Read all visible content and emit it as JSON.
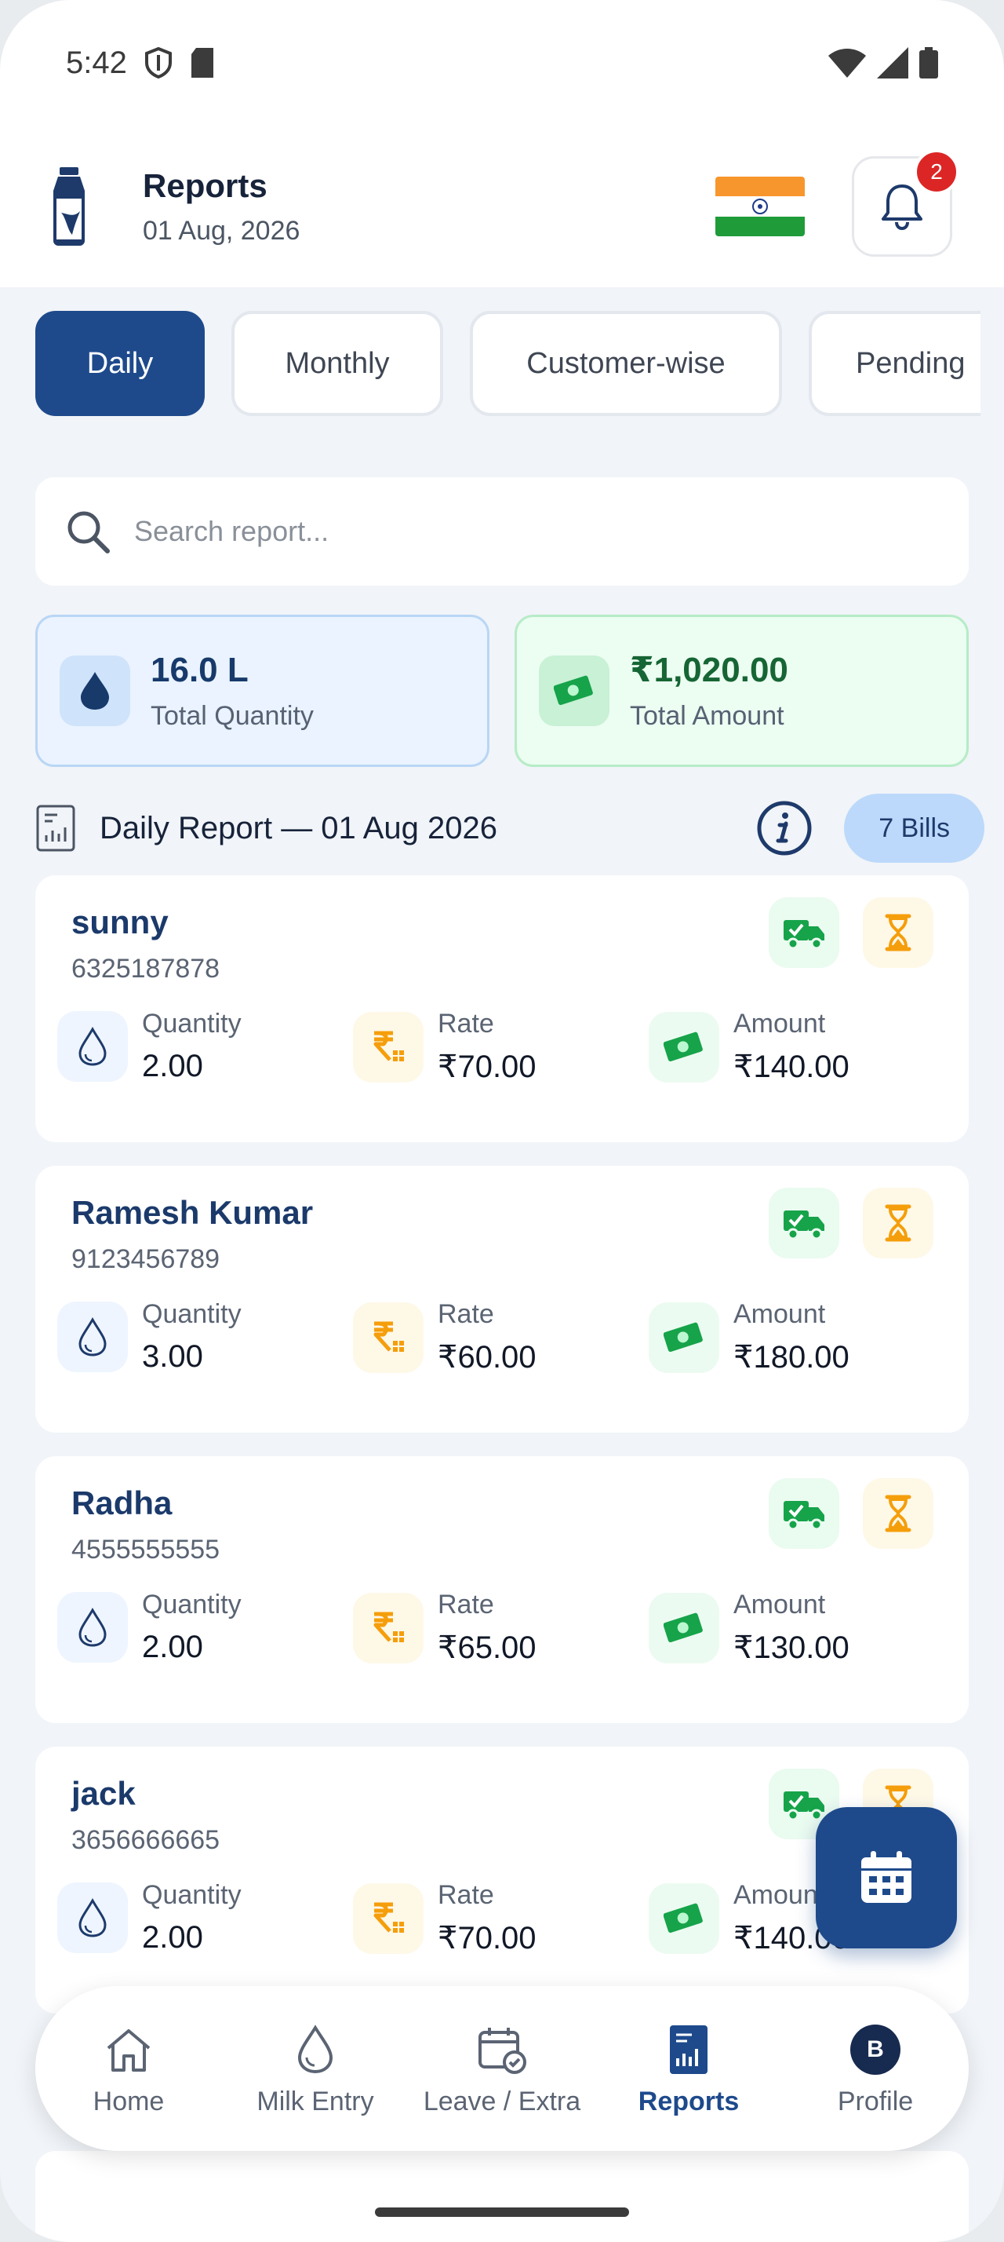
{
  "status_bar": {
    "time": "5:42"
  },
  "header": {
    "title": "Reports",
    "date": "01 Aug, 2026",
    "notification_count": "2"
  },
  "tabs": [
    {
      "label": "Daily",
      "active": true
    },
    {
      "label": "Monthly"
    },
    {
      "label": "Customer-wise"
    },
    {
      "label": "Pending"
    }
  ],
  "search": {
    "placeholder": "Search report..."
  },
  "summary": {
    "quantity_value": "16.0 L",
    "quantity_label": "Total Quantity",
    "amount_value": "₹1,020.00",
    "amount_label": "Total Amount"
  },
  "section": {
    "title": "Daily Report — 01 Aug 2026",
    "bills": "7 Bills"
  },
  "labels": {
    "quantity": "Quantity",
    "rate": "Rate",
    "amount": "Amount"
  },
  "customers": [
    {
      "name": "sunny",
      "phone": "6325187878",
      "quantity": "2.00",
      "rate": "₹70.00",
      "amount": "₹140.00"
    },
    {
      "name": "Ramesh Kumar",
      "phone": "9123456789",
      "quantity": "3.00",
      "rate": "₹60.00",
      "amount": "₹180.00"
    },
    {
      "name": "Radha",
      "phone": "4555555555",
      "quantity": "2.00",
      "rate": "₹65.00",
      "amount": "₹130.00"
    },
    {
      "name": "jack",
      "phone": "3656666665",
      "quantity": "2.00",
      "rate": "₹70.00",
      "amount": "₹140.00"
    }
  ],
  "nav": [
    {
      "label": "Home"
    },
    {
      "label": "Milk Entry"
    },
    {
      "label": "Leave / Extra"
    },
    {
      "label": "Reports",
      "active": true
    },
    {
      "label": "Profile",
      "avatar": "B"
    }
  ],
  "colors": {
    "primary": "#1e4a8c",
    "accent_green": "#16a34a",
    "accent_amber": "#f59e0b",
    "badge_red": "#dc2626"
  }
}
